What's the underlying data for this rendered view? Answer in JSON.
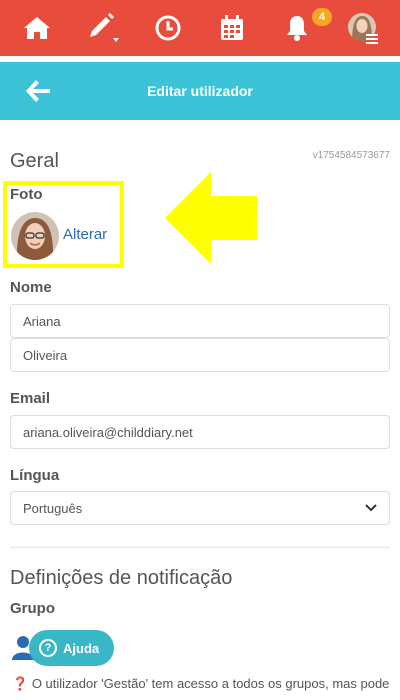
{
  "topbar": {
    "notification_count": "4",
    "icons": [
      "home-icon",
      "edit-icon",
      "clock-icon",
      "calendar-icon",
      "bell-icon"
    ]
  },
  "header": {
    "title": "Editar utilizador"
  },
  "general": {
    "title": "Geral",
    "version": "v1754584573677",
    "photo_label": "Foto",
    "photo_action": "Alterar",
    "name_label": "Nome",
    "first_name": "Ariana",
    "last_name": "Oliveira",
    "email_label": "Email",
    "email": "ariana.oliveira@childdiary.net",
    "language_label": "Língua",
    "language_selected": "Português"
  },
  "notifications": {
    "title": "Definições de notificação",
    "group_label": "Grupo",
    "info_text": "O utilizador 'Gestão' tem acesso a todos os grupos, mas pode"
  },
  "help": {
    "label": "Ajuda"
  },
  "colors": {
    "topbar": "#e74c3c",
    "header": "#3cc3d8",
    "highlight": "#ffff00",
    "link": "#2b6cb0",
    "help_button": "#3ab7c6"
  }
}
